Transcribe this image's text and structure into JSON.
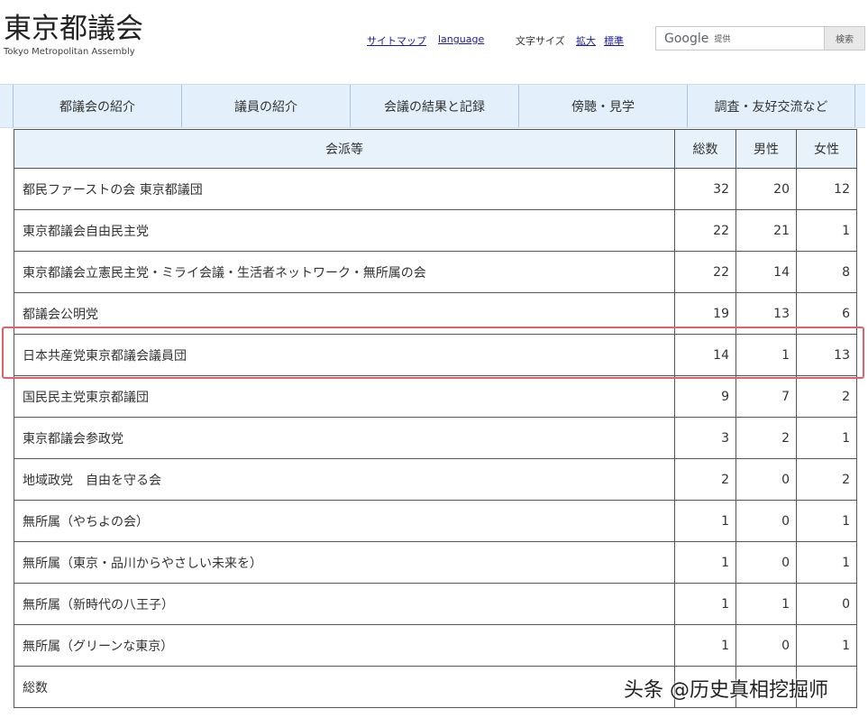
{
  "header": {
    "logo_jp": "東京都議会",
    "logo_en": "Tokyo Metropolitan Assembly",
    "sitemap": "サイトマップ",
    "language": "language",
    "font_size_label": "文字サイズ",
    "font_enlarge": "拡大",
    "font_standard": "標準",
    "search": {
      "google": "Google",
      "provided": "提供",
      "button": "検索"
    }
  },
  "nav": [
    "都議会の紹介",
    "議員の紹介",
    "会議の結果と記録",
    "傍聴・見学",
    "調査・友好交流など"
  ],
  "table": {
    "headers": [
      "会派等",
      "総数",
      "男性",
      "女性"
    ],
    "rows": [
      [
        "都民ファーストの会 東京都議団",
        "32",
        "20",
        "12"
      ],
      [
        "東京都議会自由民主党",
        "22",
        "21",
        "1"
      ],
      [
        "東京都議会立憲民主党・ミライ会議・生活者ネットワーク・無所属の会",
        "22",
        "14",
        "8"
      ],
      [
        "都議会公明党",
        "19",
        "13",
        "6"
      ],
      [
        "日本共産党東京都議会議員団",
        "14",
        "1",
        "13"
      ],
      [
        "国民民主党東京都議団",
        "9",
        "7",
        "2"
      ],
      [
        "東京都議会参政党",
        "3",
        "2",
        "1"
      ],
      [
        "地域政党　自由を守る会",
        "2",
        "0",
        "2"
      ],
      [
        "無所属（やちよの会）",
        "1",
        "0",
        "1"
      ],
      [
        "無所属（東京・品川からやさしい未来を）",
        "1",
        "0",
        "1"
      ],
      [
        "無所属（新時代の八王子）",
        "1",
        "1",
        "0"
      ],
      [
        "無所属（グリーンな東京）",
        "1",
        "0",
        "1"
      ],
      [
        "総数",
        "",
        "",
        ""
      ]
    ]
  },
  "highlight_color": "#e35f6a",
  "watermark": "头条 @历史真相挖掘师"
}
